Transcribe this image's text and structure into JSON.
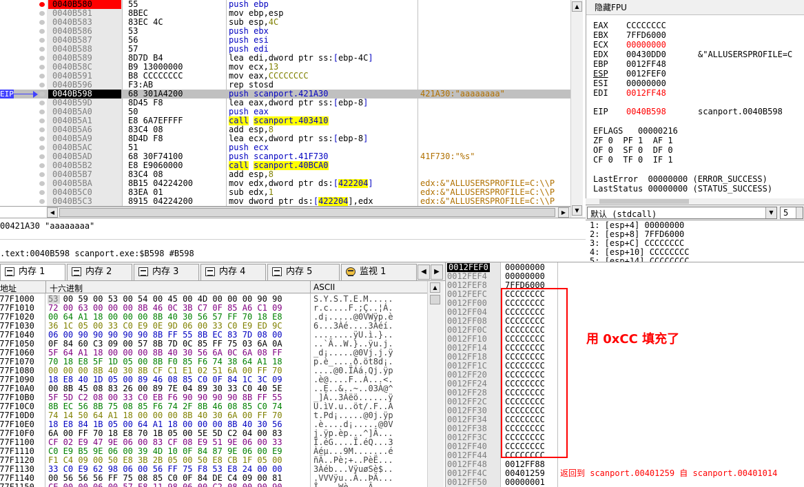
{
  "disasm": {
    "rows": [
      {
        "addr": "0040B580",
        "hex": "55",
        "code": [
          {
            "t": "push ebp",
            "c": "blue"
          }
        ],
        "comment": ""
      },
      {
        "addr": "0040B581",
        "hex": "8BEC",
        "code": [
          {
            "t": "mov ebp,esp"
          }
        ],
        "comment": ""
      },
      {
        "addr": "0040B583",
        "hex": "83EC 4C",
        "code": [
          {
            "t": "sub esp,"
          },
          {
            "t": "4C",
            "c": "olive"
          }
        ],
        "comment": ""
      },
      {
        "addr": "0040B586",
        "hex": "53",
        "code": [
          {
            "t": "push ebx",
            "c": "blue"
          }
        ],
        "comment": ""
      },
      {
        "addr": "0040B587",
        "hex": "56",
        "code": [
          {
            "t": "push esi",
            "c": "blue"
          }
        ],
        "comment": ""
      },
      {
        "addr": "0040B588",
        "hex": "57",
        "code": [
          {
            "t": "push edi",
            "c": "blue"
          }
        ],
        "comment": ""
      },
      {
        "addr": "0040B589",
        "hex": "8D7D B4",
        "code": [
          {
            "t": "lea edi,dword ptr ss:"
          },
          {
            "t": "[",
            "c": "blue"
          },
          {
            "t": "ebp-4C"
          },
          {
            "t": "]",
            "c": "blue"
          }
        ],
        "comment": ""
      },
      {
        "addr": "0040B58C",
        "hex": "B9 13000000",
        "code": [
          {
            "t": "mov ecx,"
          },
          {
            "t": "13",
            "c": "olive"
          }
        ],
        "comment": ""
      },
      {
        "addr": "0040B591",
        "hex": "B8 CCCCCCCC",
        "code": [
          {
            "t": "mov eax,"
          },
          {
            "t": "CCCCCCCC",
            "c": "olive"
          }
        ],
        "comment": ""
      },
      {
        "addr": "0040B596",
        "hex": "F3:AB",
        "code": [
          {
            "t": "rep stosd"
          }
        ],
        "comment": ""
      },
      {
        "addr": "0040B598",
        "hex": "68 301A4200",
        "code": [
          {
            "t": "push scanport.421A30",
            "c": "blue"
          }
        ],
        "comment": "421A30:\"aaaaaaaa\""
      },
      {
        "addr": "0040B59D",
        "hex": "8D45 F8",
        "code": [
          {
            "t": "lea eax,dword ptr ss:"
          },
          {
            "t": "[",
            "c": "blue"
          },
          {
            "t": "ebp-8"
          },
          {
            "t": "]",
            "c": "blue"
          }
        ],
        "comment": ""
      },
      {
        "addr": "0040B5A0",
        "hex": "50",
        "code": [
          {
            "t": "push eax",
            "c": "blue"
          }
        ],
        "comment": ""
      },
      {
        "addr": "0040B5A1",
        "hex": "E8 6A7EFFFF",
        "code": [
          {
            "t": "call",
            "c": "yelcall"
          },
          {
            "t": " "
          },
          {
            "t": "scanport.403410",
            "c": "yel"
          }
        ],
        "comment": ""
      },
      {
        "addr": "0040B5A6",
        "hex": "83C4 08",
        "code": [
          {
            "t": "add esp,"
          },
          {
            "t": "8",
            "c": "olive"
          }
        ],
        "comment": ""
      },
      {
        "addr": "0040B5A9",
        "hex": "8D4D F8",
        "code": [
          {
            "t": "lea ecx,dword ptr ss:"
          },
          {
            "t": "[",
            "c": "blue"
          },
          {
            "t": "ebp-8"
          },
          {
            "t": "]",
            "c": "blue"
          }
        ],
        "comment": ""
      },
      {
        "addr": "0040B5AC",
        "hex": "51",
        "code": [
          {
            "t": "push ecx",
            "c": "blue"
          }
        ],
        "comment": ""
      },
      {
        "addr": "0040B5AD",
        "hex": "68 30F74100",
        "code": [
          {
            "t": "push scanport.41F730",
            "c": "blue"
          }
        ],
        "comment": "41F730:\"%s\""
      },
      {
        "addr": "0040B5B2",
        "hex": "E8 E9060000",
        "code": [
          {
            "t": "call",
            "c": "yelcall"
          },
          {
            "t": " "
          },
          {
            "t": "scanport.40BCA0",
            "c": "yel"
          }
        ],
        "comment": ""
      },
      {
        "addr": "0040B5B7",
        "hex": "83C4 08",
        "code": [
          {
            "t": "add esp,"
          },
          {
            "t": "8",
            "c": "olive"
          }
        ],
        "comment": ""
      },
      {
        "addr": "0040B5BA",
        "hex": "8B15 04224200",
        "code": [
          {
            "t": "mov edx,dword ptr ds:"
          },
          {
            "t": "[",
            "c": "blue"
          },
          {
            "t": "422204",
            "c": "yel"
          },
          {
            "t": "]",
            "c": "blue"
          }
        ],
        "comment": "edx:&\"ALLUSERSPROFILE=C:\\\\P"
      },
      {
        "addr": "0040B5C0",
        "hex": "83EA 01",
        "code": [
          {
            "t": "sub edx,"
          },
          {
            "t": "1",
            "c": "olive"
          }
        ],
        "comment": "edx:&\"ALLUSERSPROFILE=C:\\\\P"
      },
      {
        "addr": "0040B5C3",
        "hex": "8915 04224200",
        "code": [
          {
            "t": "mov dword ptr ds:"
          },
          {
            "t": "[",
            "c": "blue"
          },
          {
            "t": "422204",
            "c": "yel"
          },
          {
            "t": "]"
          },
          {
            "t": ",edx"
          }
        ],
        "comment": "edx:&\"ALLUSERSPROFILE=C:\\\\P"
      }
    ],
    "eip_label": "EIP"
  },
  "info": {
    "line1": "00421A30 \"aaaaaaaa\"",
    "line2": ".text:0040B598 scanport.exe:$B598 #B598"
  },
  "registers": {
    "title": "隐藏FPU",
    "gp": [
      {
        "n": "EAX",
        "v": "CCCCCCCC",
        "red": false,
        "x": ""
      },
      {
        "n": "EBX",
        "v": "7FFD6000",
        "red": false,
        "x": ""
      },
      {
        "n": "ECX",
        "v": "00000000",
        "red": true,
        "x": ""
      },
      {
        "n": "EDX",
        "v": "00430DD0",
        "red": false,
        "x": "&\"ALLUSERSPROFILE=C"
      },
      {
        "n": "EBP",
        "v": "0012FF48",
        "red": false,
        "x": ""
      },
      {
        "n": "ESP",
        "v": "0012FEF0",
        "red": false,
        "x": ""
      },
      {
        "n": "ESI",
        "v": "00000000",
        "red": false,
        "x": ""
      },
      {
        "n": "EDI",
        "v": "0012FF48",
        "red": true,
        "x": ""
      }
    ],
    "eip": {
      "n": "EIP",
      "v": "0040B598",
      "x": "scanport.0040B598"
    },
    "eflags": "EFLAGS   00000216",
    "flags": [
      "ZF 0  PF 1  AF 1",
      "OF 0  SF 0  DF 0",
      "CF 0  TF 0  IF 1"
    ],
    "lasterror": "LastError  00000000 (ERROR_SUCCESS)",
    "laststatus": "LastStatus 00000000 (STATUS_SUCCESS)"
  },
  "callconv": {
    "selected": "默认 (stdcall)",
    "count": "5"
  },
  "args": [
    "1: [esp+4] 00000000",
    "2: [esp+8] 7FFD6000",
    "3: [esp+C] CCCCCCCC",
    "4: [esp+10] CCCCCCCC",
    "5: [esp+14] CCCCCCCC"
  ],
  "tabs": [
    "内存 1",
    "内存 2",
    "内存 3",
    "内存 4",
    "内存 5",
    "监视 1"
  ],
  "dump": {
    "headers": {
      "addr": "地址",
      "hex": "十六进制",
      "ascii": "ASCII"
    },
    "rows": [
      {
        "a": "777F1000",
        "h": "53 00 59 00 53 00 54 00 45 00 4D 00 00 00 90 90",
        "s": "S.Y.S.T.E.M....."
      },
      {
        "a": "777F1010",
        "h": "72 00 63 00 00 00 8B 46 0C 3B C7 0F 85 A6 C1 09",
        "s": "r.c....F.;Ç..¦Á."
      },
      {
        "a": "777F1020",
        "h": "00 64 A1 18 00 00 00 8B 40 30 56 57 FF 70 18 E8",
        "s": ".d¡.....@0VWÿp.è"
      },
      {
        "a": "777F1030",
        "h": "36 1C 05 00 33 C0 E9 0E 9D 06 00 33 C0 E9 ED 9C",
        "s": "6...3Àé....3Àéí."
      },
      {
        "a": "777F1040",
        "h": "06 00 90 90 90 90 90 8B FF 55 8B EC 83 7D 08 00",
        "s": "........ÿU.ì.}.."
      },
      {
        "a": "777F1050",
        "h": "0F 84 60 C3 09 00 57 8B 7D 0C 85 FF 75 03 6A 0A",
        "s": "..`Ã..W.}..ÿu.j."
      },
      {
        "a": "777F1060",
        "h": "5F 64 A1 18 00 00 00 8B 40 30 56 6A 0C 6A 08 FF",
        "s": "_d¡.....@0Vj.j.ÿ"
      },
      {
        "a": "777F1070",
        "h": "70 18 E8 5F 1D 05 00 8B F0 85 F6 74 38 64 A1 18",
        "s": "p.è_....ð.öt8d¡."
      },
      {
        "a": "777F1080",
        "h": "00 00 00 8B 40 30 8B CF C1 E1 02 51 6A 00 FF 70",
        "s": "....@0.ÏÁá.Qj.ÿp"
      },
      {
        "a": "777F1090",
        "h": "18 E8 40 1D 05 00 89 46 08 85 C0 0F 84 1C 3C 09",
        "s": ".è@....F..À...<."
      },
      {
        "a": "777F10A0",
        "h": "00 8B 45 08 83 26 00 89 7E 04 89 30 33 C0 40 5E",
        "s": "..E..&..~..03À@^"
      },
      {
        "a": "777F10B0",
        "h": "5F 5D C2 08 00 33 C0 EB F6 90 90 90 90 8B FF 55",
        "s": "_]Â..3Àëö......ÿ"
      },
      {
        "a": "777F10C0",
        "h": "8B EC 56 8B 75 08 85 F6 74 2F 8B 46 08 85 C0 74",
        "s": "U.ìV.u..öt/.F..À"
      },
      {
        "a": "777F10D0",
        "h": "74 14 50 64 A1 18 00 00 00 8B 40 30 6A 00 FF 70",
        "s": "t.Pd¡.....@0j.ÿp"
      },
      {
        "a": "777F10E0",
        "h": "18 E8 84 1B 05 00 64 A1 18 00 00 00 8B 40 30 56",
        "s": ".è....d¡.....@0V"
      },
      {
        "a": "777F10F0",
        "h": "6A 00 FF 70 18 E8 70 1B 05 00 5E 5D C2 04 00 83",
        "s": "j.ÿp.èp...^]Â..."
      },
      {
        "a": "777F1100",
        "h": "CF 02 E9 47 9E 06 00 83 CF 08 E9 51 9E 06 00 33",
        "s": "Ï.éG....Ï.éQ...3"
      },
      {
        "a": "777F1110",
        "h": "C0 E9 B5 9E 06 00 39 4D 10 0F 84 87 9E 06 00 E9",
        "s": "Àéµ...9M.......é"
      },
      {
        "a": "777F1120",
        "h": "F1 C4 09 00 50 E8 3B 2B 05 00 50 E8 CB 1F 05 00",
        "s": "ñÄ..Pè;+..PèË..."
      },
      {
        "a": "777F1130",
        "h": "33 C0 E9 62 98 06 00 56 FF 75 F8 53 E8 24 00 00",
        "s": "3Àéb...VÿuøSè$.."
      },
      {
        "a": "777F1140",
        "h": "00 56 56 56 FF 75 08 85 C0 0F 84 DE C4 09 00 81",
        "s": ".VVVÿu..À..ÞÄ..."
      },
      {
        "a": "777F1150",
        "h": "CE 00 00 06 00 57 E8 11 98 06 00 C2 08 00 90 90",
        "s": "Î....Wè....Â...."
      }
    ]
  },
  "stack": {
    "rows": [
      {
        "a": "0012FEF0",
        "v": "00000000",
        "c": ""
      },
      {
        "a": "0012FEF4",
        "v": "00000000",
        "c": ""
      },
      {
        "a": "0012FEF8",
        "v": "7FFD6000",
        "c": ""
      },
      {
        "a": "0012FEFC",
        "v": "CCCCCCCC",
        "c": ""
      },
      {
        "a": "0012FF00",
        "v": "CCCCCCCC",
        "c": ""
      },
      {
        "a": "0012FF04",
        "v": "CCCCCCCC",
        "c": ""
      },
      {
        "a": "0012FF08",
        "v": "CCCCCCCC",
        "c": ""
      },
      {
        "a": "0012FF0C",
        "v": "CCCCCCCC",
        "c": ""
      },
      {
        "a": "0012FF10",
        "v": "CCCCCCCC",
        "c": ""
      },
      {
        "a": "0012FF14",
        "v": "CCCCCCCC",
        "c": ""
      },
      {
        "a": "0012FF18",
        "v": "CCCCCCCC",
        "c": ""
      },
      {
        "a": "0012FF1C",
        "v": "CCCCCCCC",
        "c": ""
      },
      {
        "a": "0012FF20",
        "v": "CCCCCCCC",
        "c": ""
      },
      {
        "a": "0012FF24",
        "v": "CCCCCCCC",
        "c": ""
      },
      {
        "a": "0012FF28",
        "v": "CCCCCCCC",
        "c": ""
      },
      {
        "a": "0012FF2C",
        "v": "CCCCCCCC",
        "c": ""
      },
      {
        "a": "0012FF30",
        "v": "CCCCCCCC",
        "c": ""
      },
      {
        "a": "0012FF34",
        "v": "CCCCCCCC",
        "c": ""
      },
      {
        "a": "0012FF38",
        "v": "CCCCCCCC",
        "c": ""
      },
      {
        "a": "0012FF3C",
        "v": "CCCCCCCC",
        "c": ""
      },
      {
        "a": "0012FF40",
        "v": "CCCCCCCC",
        "c": ""
      },
      {
        "a": "0012FF44",
        "v": "CCCCCCCC",
        "c": ""
      },
      {
        "a": "0012FF48",
        "v": "0012FF88",
        "c": ""
      },
      {
        "a": "0012FF4C",
        "v": "00401259",
        "c": "返回到 scanport.00401259 自 scanport.00401014"
      },
      {
        "a": "0012FF50",
        "v": "00000001",
        "c": ""
      }
    ],
    "annotation": "用 0xCC 填充了"
  },
  "colors": {
    "accent": "#ff0000",
    "selection": "#000000",
    "callHighlight": "#ffff00",
    "panel": "#f0f0f0"
  }
}
